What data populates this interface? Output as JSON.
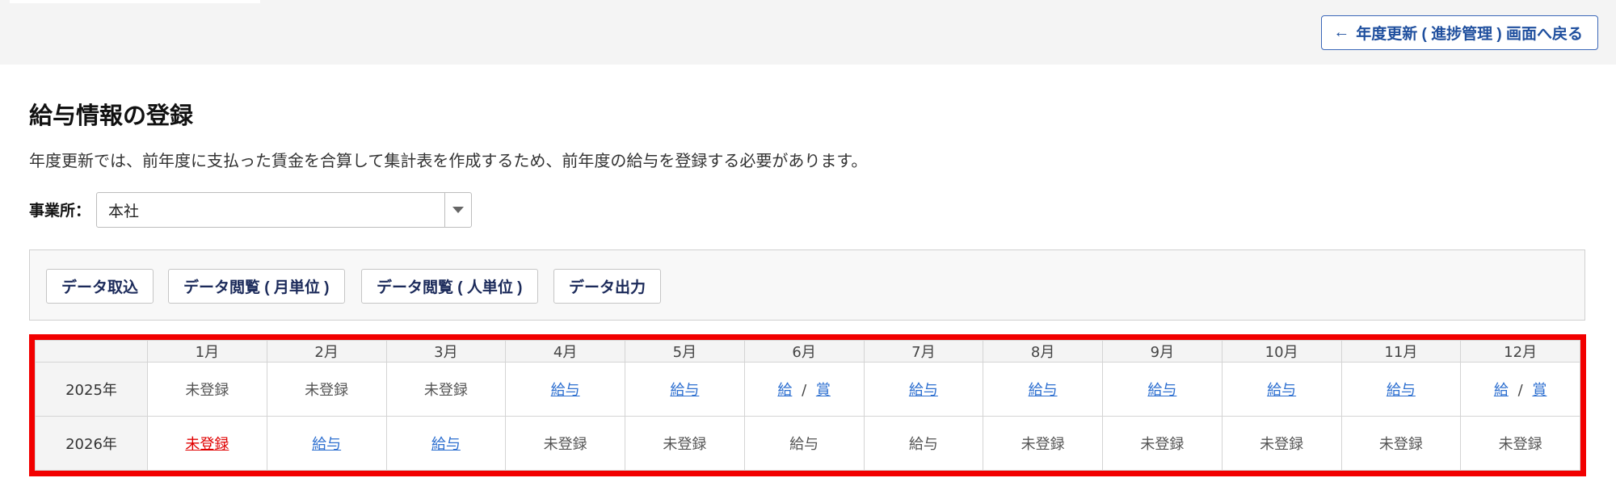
{
  "header": {
    "back_label": "年度更新 ( 進捗管理 ) 画面へ戻る"
  },
  "page": {
    "title": "給与情報の登録",
    "description": "年度更新では、前年度に支払った賃金を合算して集計表を作成するため、前年度の給与を登録する必要があります。"
  },
  "office": {
    "label": "事業所：",
    "selected": "本社"
  },
  "actions": {
    "import_label": "データ取込",
    "view_monthly_label": "データ閲覧 ( 月単位 )",
    "view_person_label": "データ閲覧 ( 人単位 )",
    "export_label": "データ出力"
  },
  "table": {
    "months": [
      "1月",
      "2月",
      "3月",
      "4月",
      "5月",
      "6月",
      "7月",
      "8月",
      "9月",
      "10月",
      "11月",
      "12月"
    ],
    "rows": [
      {
        "year": "2025年",
        "cells": [
          {
            "type": "plain",
            "text": "未登録"
          },
          {
            "type": "plain",
            "text": "未登録"
          },
          {
            "type": "plain",
            "text": "未登録"
          },
          {
            "type": "link",
            "text": "給与"
          },
          {
            "type": "link",
            "text": "給与"
          },
          {
            "type": "pair",
            "a": "給",
            "sep": "/",
            "b": "賞"
          },
          {
            "type": "link",
            "text": "給与"
          },
          {
            "type": "link",
            "text": "給与"
          },
          {
            "type": "link",
            "text": "給与"
          },
          {
            "type": "link",
            "text": "給与"
          },
          {
            "type": "link",
            "text": "給与"
          },
          {
            "type": "pair",
            "a": "給",
            "sep": "/",
            "b": "賞"
          }
        ]
      },
      {
        "year": "2026年",
        "cells": [
          {
            "type": "link-red",
            "text": "未登録"
          },
          {
            "type": "link",
            "text": "給与"
          },
          {
            "type": "link",
            "text": "給与"
          },
          {
            "type": "plain",
            "text": "未登録"
          },
          {
            "type": "plain",
            "text": "未登録"
          },
          {
            "type": "plain",
            "text": "給与"
          },
          {
            "type": "plain",
            "text": "給与"
          },
          {
            "type": "plain",
            "text": "未登録"
          },
          {
            "type": "plain",
            "text": "未登録"
          },
          {
            "type": "plain",
            "text": "未登録"
          },
          {
            "type": "plain",
            "text": "未登録"
          },
          {
            "type": "plain",
            "text": "未登録"
          }
        ]
      }
    ]
  },
  "colors": {
    "link": "#2d6fd0",
    "link_red": "#e00000",
    "highlight_border": "#f20000",
    "back_button_text": "#1f4f9e"
  }
}
